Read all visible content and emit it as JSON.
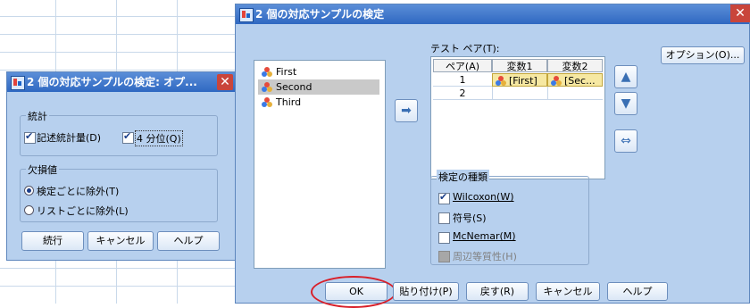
{
  "main_dialog": {
    "title": "2 個の対応サンプルの検定",
    "close_symbol": "✕",
    "variables": [
      {
        "name": "First",
        "selected": false
      },
      {
        "name": "Second",
        "selected": true
      },
      {
        "name": "Third",
        "selected": false
      }
    ],
    "test_pair_label": "テスト ペア(T):",
    "table_headers": [
      "ペア(A)",
      "変数1",
      "変数2"
    ],
    "table_rows": [
      {
        "pair": "1",
        "var1": "[First]",
        "var2": "[Sec..."
      },
      {
        "pair": "2",
        "var1": "",
        "var2": ""
      }
    ],
    "options_button": "オプション(O)...",
    "test_type_legend": "検定の種類",
    "tests": [
      {
        "label": "Wilcoxon(W)",
        "checked": true,
        "enabled": true
      },
      {
        "label": "符号(S)",
        "checked": false,
        "enabled": true
      },
      {
        "label": "McNemar(M)",
        "checked": false,
        "enabled": true
      },
      {
        "label": "周辺等質性(H)",
        "checked": false,
        "enabled": false
      }
    ],
    "buttons": {
      "ok": "OK",
      "paste": "貼り付け(P)",
      "reset": "戻す(R)",
      "cancel": "キャンセル",
      "help": "ヘルプ"
    },
    "move_symbol": "➡",
    "up_symbol": "▲",
    "down_symbol": "▼",
    "swap_symbol": "⇔"
  },
  "options_dialog": {
    "title": "2 個の対応サンプルの検定: オプ...",
    "close_symbol": "✕",
    "stats_legend": "統計",
    "stats": [
      {
        "label": "記述統計量(D)",
        "checked": true
      },
      {
        "label": "4 分位(Q)",
        "checked": true
      }
    ],
    "missing_legend": "欠損値",
    "missing": [
      {
        "label": "検定ごとに除外(T)",
        "selected": true
      },
      {
        "label": "リストごとに除外(L)",
        "selected": false
      }
    ],
    "buttons": {
      "continue": "続行",
      "cancel": "キャンセル",
      "help": "ヘルプ"
    }
  },
  "colors": {
    "highlight_ring": "#d8202a",
    "title_bar": "#3a74cc",
    "dialog_bg": "#b7d0ee"
  }
}
